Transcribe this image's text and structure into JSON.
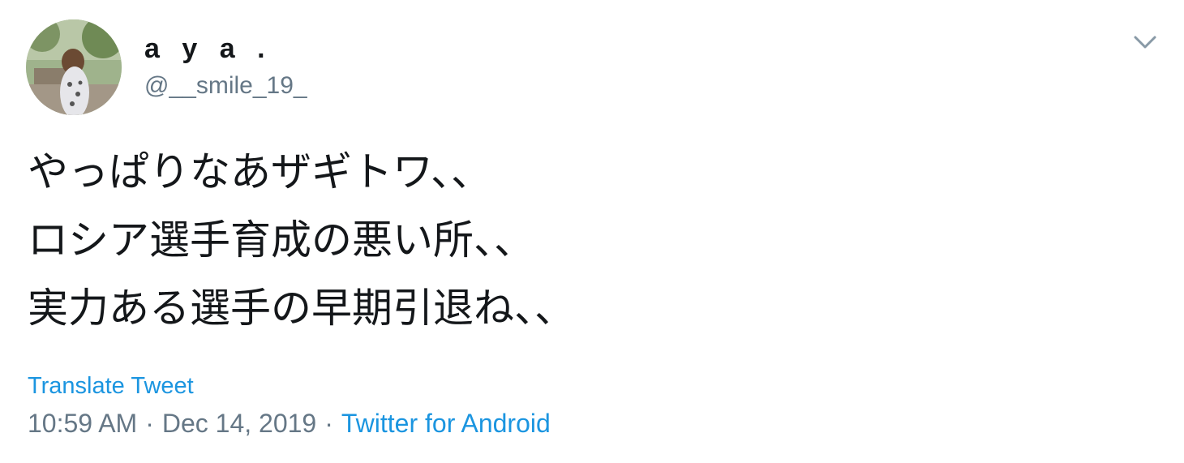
{
  "tweet": {
    "author": {
      "display_name": "a y a .",
      "handle": "@__smile_19_",
      "avatar_icon": "profile-photo"
    },
    "menu_icon": "chevron-down-icon",
    "text_lines": [
      "やっぱりなあザギトワ、、",
      "ロシア選手育成の悪い所、、",
      "実力ある選手の早期引退ね、、"
    ],
    "translate_label": "Translate Tweet",
    "time": "10:59 AM",
    "separator": "·",
    "date": "Dec 14, 2019",
    "source": "Twitter for Android"
  },
  "colors": {
    "text": "#14171a",
    "secondary": "#657786",
    "link": "#1b95e0"
  }
}
